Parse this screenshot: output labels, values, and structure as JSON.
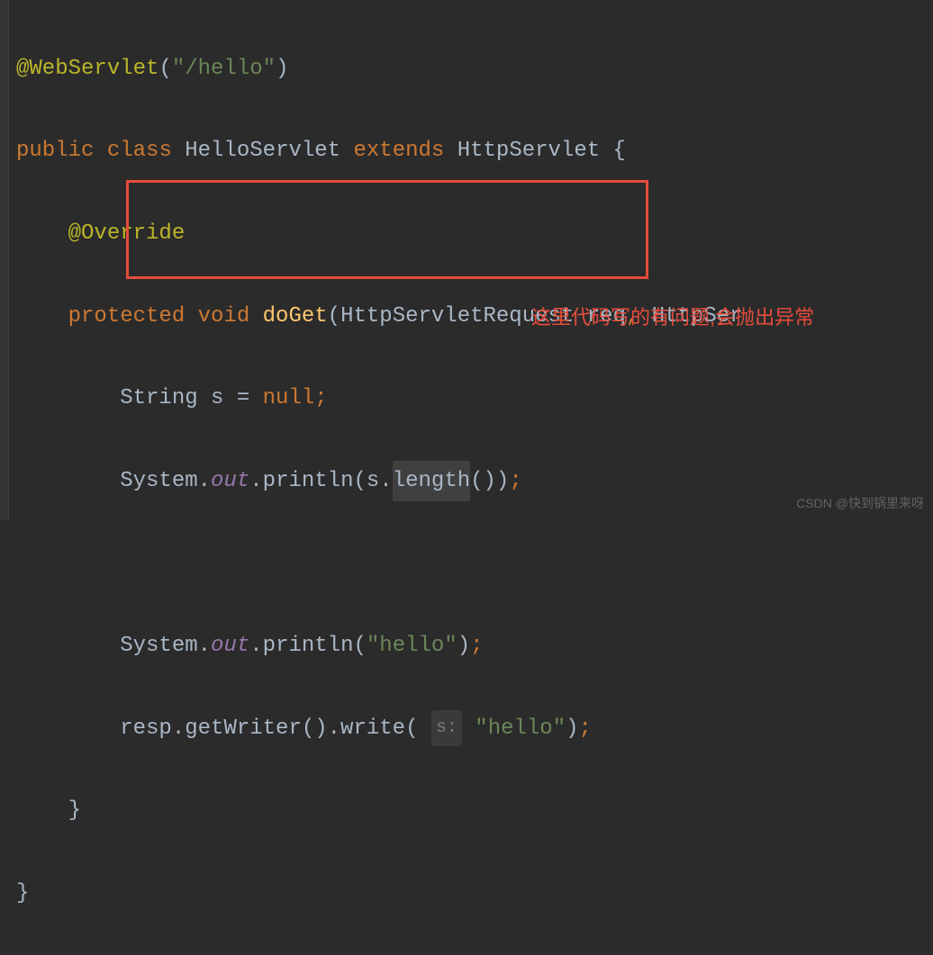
{
  "code": {
    "line1_annotation": "@WebServlet",
    "line1_paren_open": "(",
    "line1_string": "\"/hello\"",
    "line1_paren_close": ")",
    "line2_public": "public ",
    "line2_class": "class ",
    "line2_classname": "HelloServlet ",
    "line2_extends": "extends ",
    "line2_parent": "HttpServlet ",
    "line2_brace": "{",
    "line3_indent": "    ",
    "line3_override": "@Override",
    "line4_indent": "    ",
    "line4_protected": "protected ",
    "line4_void": "void ",
    "line4_method": "doGet",
    "line4_paren_open": "(",
    "line4_param1_type": "HttpServletRequest req",
    "line4_comma": ", ",
    "line4_param2_type": "HttpSer",
    "line5_indent": "        ",
    "line5_type": "String s = ",
    "line5_null": "null",
    "line5_semi": ";",
    "line6_indent": "        ",
    "line6_system": "System.",
    "line6_out": "out",
    "line6_println": ".println(s.",
    "line6_length": "length",
    "line6_end": "())",
    "line6_semi": ";",
    "line7_blank": "",
    "line8_indent": "        ",
    "line8_system": "System.",
    "line8_out": "out",
    "line8_println": ".println(",
    "line8_string": "\"hello\"",
    "line8_end": ")",
    "line8_semi": ";",
    "line9_indent": "        ",
    "line9_resp": "resp.getWriter().write( ",
    "line9_hint": "s:",
    "line9_space": " ",
    "line9_string": "\"hello\"",
    "line9_end": ")",
    "line9_semi": ";",
    "line10_indent": "    ",
    "line10_brace": "}",
    "line11_brace": "}"
  },
  "annotation": "这里代码写的有问题,会抛出异常",
  "watermark": "CSDN @快到锅里来呀"
}
